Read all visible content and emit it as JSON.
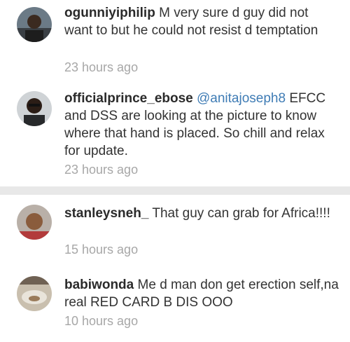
{
  "comments": [
    {
      "username": "ogunniyiphilip",
      "mention": "",
      "text": "M very sure d guy did not want to but he could not resist d temptation",
      "timestamp": "23 hours ago",
      "avatar_icon": "user-avatar"
    },
    {
      "username": "officialprince_ebose",
      "mention": "@anitajoseph8",
      "text": "EFCC and DSS are looking at the picture to know where that hand is placed. So chill and relax for update.",
      "timestamp": "23 hours ago",
      "avatar_icon": "user-avatar"
    },
    {
      "username": "stanleysneh_",
      "mention": "",
      "text": "That guy can grab for Africa!!!!",
      "timestamp": "15 hours ago",
      "avatar_icon": "user-avatar"
    },
    {
      "username": "babiwonda",
      "mention": "",
      "text": "Me d man don get erection self,na real RED CARD B DIS OOO",
      "timestamp": "10 hours ago",
      "avatar_icon": "user-avatar"
    }
  ],
  "colors": {
    "username": "#2a2a2a",
    "mention": "#3f7cb5",
    "timestamp": "#a7a7a7",
    "text": "#333333",
    "separator": "#e8e8e8"
  }
}
